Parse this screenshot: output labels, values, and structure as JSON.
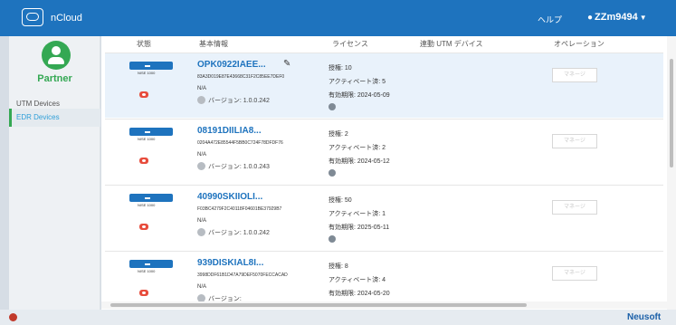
{
  "app": {
    "title": "nCloud"
  },
  "header": {
    "help": "ヘルプ",
    "user": "ZZm9494"
  },
  "sidebar": {
    "role": "Partner",
    "items": [
      {
        "label": "UTM Devices"
      },
      {
        "label": "EDR Devices"
      }
    ]
  },
  "table": {
    "headers": {
      "status": "状態",
      "basic": "基本情報",
      "license": "ライセンス",
      "utm": "連動 UTM デバイス",
      "operation": "オペレーション"
    },
    "rows": [
      {
        "name": "OPK0922IAEE...",
        "serial": "83A3D019E87E43668C31F2C85EE7DEF0",
        "na": "N/A",
        "version": "バージョン: 1.0.0.242",
        "model": "NISE 1000",
        "granted": "授権: 10",
        "active": "アクティベート済: 5",
        "expiry": "有効期限: 2024-05-09",
        "manage": "マネージ"
      },
      {
        "name": "08191DIILIA8...",
        "serial": "0204A472E85544F5BB0C724F78DFDF76",
        "na": "N/A",
        "version": "バージョン: 1.0.0.243",
        "model": "NISE 1000",
        "granted": "授権: 2",
        "active": "アクティベート済: 2",
        "expiry": "有効期限: 2024-05-12",
        "manage": "マネージ"
      },
      {
        "name": "40990SKIIOLI...",
        "serial": "F03BC4279F2C40118F04601BE37929B7",
        "na": "N/A",
        "version": "バージョン: 1.0.0.242",
        "model": "NISE 1000",
        "granted": "授権: 50",
        "active": "アクティベート済: 1",
        "expiry": "有効期限: 2025-05-11",
        "manage": "マネージ"
      },
      {
        "name": "939DISKIAL8I...",
        "serial": "3998DDF61B1D47A79DEF5070FECCACAD",
        "na": "N/A",
        "version": "バージョン:",
        "model": "NISE 1000",
        "granted": "授権: 8",
        "active": "アクティベート済: 4",
        "expiry": "有効期限: 2024-05-20",
        "manage": "マネージ"
      }
    ]
  },
  "footer": {
    "brand": "Neusoft"
  }
}
